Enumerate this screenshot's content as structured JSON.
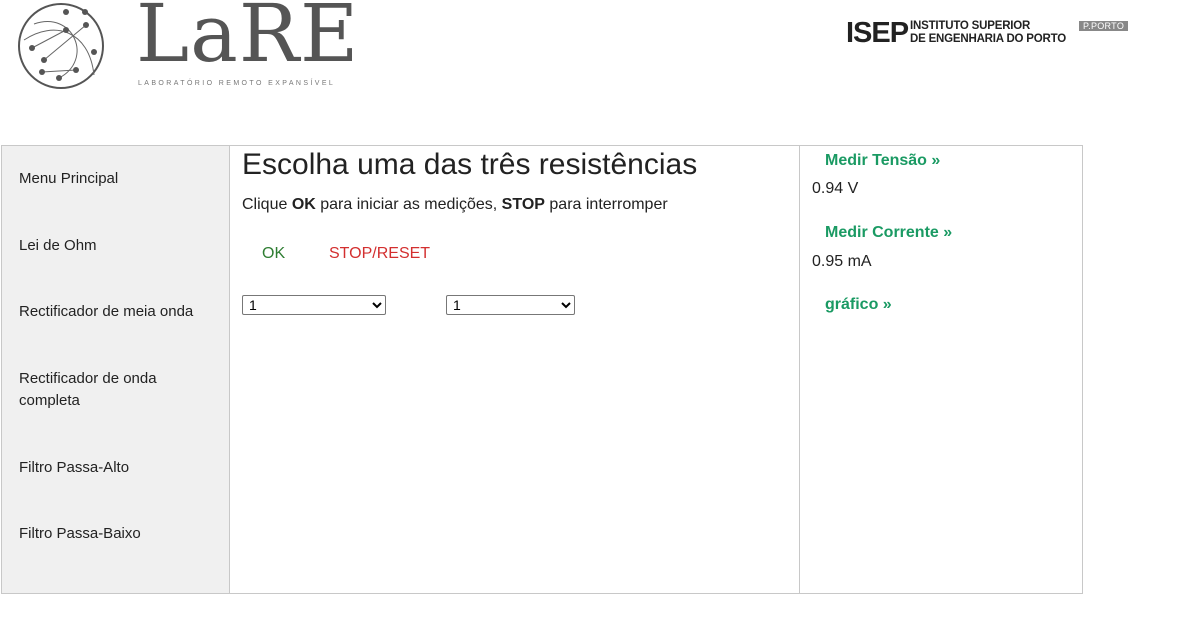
{
  "brand": {
    "name": "LaRE",
    "subtitle": "LABORATÓRIO REMOTO EXPANSÍVEL",
    "institution_code": "ISEP",
    "institution_name_line1": "INSTITUTO SUPERIOR",
    "institution_name_line2": "DE ENGENHARIA DO PORTO",
    "affiliation": "P.PORTO"
  },
  "sidebar": {
    "items": [
      {
        "label": "Menu Principal"
      },
      {
        "label": "Lei de Ohm"
      },
      {
        "label": "Rectificador de meia onda"
      },
      {
        "label": "Rectificador de onda completa"
      },
      {
        "label": "Filtro Passa-Alto"
      },
      {
        "label": "Filtro Passa-Baixo"
      }
    ]
  },
  "main": {
    "title": "Escolha uma das três resistências",
    "instruction_prefix": "Clique ",
    "instruction_ok": "OK",
    "instruction_middle": " para iniciar as medições, ",
    "instruction_stop": "STOP",
    "instruction_suffix": " para interromper",
    "ok_label": "OK",
    "stop_label": "STOP/RESET",
    "select1_value": "1",
    "select2_value": "1"
  },
  "measurements": {
    "voltage_link": "Medir Tensão »",
    "voltage_value": "0.94 V",
    "current_link": "Medir Corrente »",
    "current_value": "0.95 mA",
    "graph_link": "gráfico »"
  },
  "colors": {
    "link_green": "#1a9a63",
    "ok_green": "#2e7d32",
    "stop_red": "#d32f2f",
    "sidebar_bg": "#f0f0f0"
  }
}
